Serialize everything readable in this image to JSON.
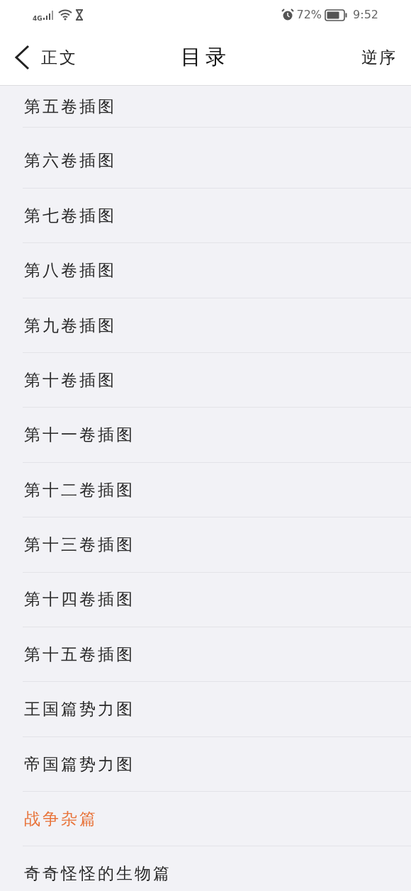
{
  "status_bar": {
    "network": "4G",
    "battery": "72%",
    "time": "9:52"
  },
  "header": {
    "back_label": "正文",
    "title": "目录",
    "action": "逆序"
  },
  "chapters": [
    {
      "title": "第五卷插图",
      "selected": false
    },
    {
      "title": "第六卷插图",
      "selected": false
    },
    {
      "title": "第七卷插图",
      "selected": false
    },
    {
      "title": "第八卷插图",
      "selected": false
    },
    {
      "title": "第九卷插图",
      "selected": false
    },
    {
      "title": "第十卷插图",
      "selected": false
    },
    {
      "title": "第十一卷插图",
      "selected": false
    },
    {
      "title": "第十二卷插图",
      "selected": false
    },
    {
      "title": "第十三卷插图",
      "selected": false
    },
    {
      "title": "第十四卷插图",
      "selected": false
    },
    {
      "title": "第十五卷插图",
      "selected": false
    },
    {
      "title": "王国篇势力图",
      "selected": false
    },
    {
      "title": "帝国篇势力图",
      "selected": false
    },
    {
      "title": "战争杂篇",
      "selected": true
    },
    {
      "title": "奇奇怪怪的生物篇",
      "selected": false
    }
  ]
}
